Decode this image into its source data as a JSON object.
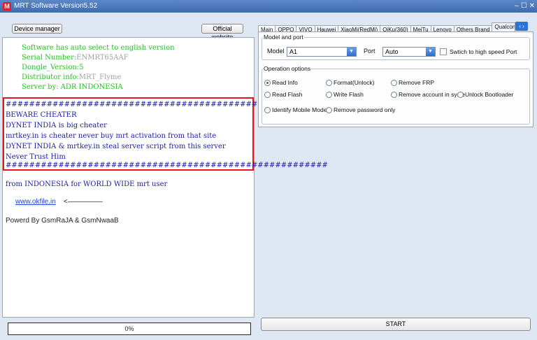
{
  "window": {
    "title": "MRT Software Version5.52",
    "app_icon_glyph": "M",
    "minimize_glyph": "–",
    "close_glyph": "☐ ✕"
  },
  "left": {
    "device_manager_label": "Device manager",
    "official_website_label": "Official website",
    "info_lines": {
      "auto_select": "Software has auto select to english version",
      "serial_label": "Serial Number:",
      "serial_value": "ENMRT65AAF",
      "dongle": "Dongle_Version:5",
      "distributor_label": "Distributor info:",
      "distributor_value": "MRT_Flyme",
      "server": "Server by: ADR INDONESIA"
    },
    "warning": {
      "hash_line_top": "#######################################################",
      "line1": "BEWARE CHEATER",
      "line2": "DYNET INDIA is big cheater",
      "line3": "mrtkey.in is cheater never buy mrt activation from that site",
      "line4": "DYNET INDIA & mrtkey.in steal server script from this server",
      "line5": "Never Trust Him",
      "hash_line_bottom": "#######################################################"
    },
    "from_line": "from INDONESIA for WORLD WIDE mrt user",
    "link_text": "www.okfile.in",
    "link_arrow": "<—————",
    "powered_by": "Powerd By GsmRaJA & GsmNwaaB",
    "progress_text": "0%"
  },
  "right": {
    "tabs": [
      "Main",
      "OPPO",
      "VIVO",
      "Hauwei",
      "XiaoMi(RedMi)",
      "QiKu(360)",
      "MeiTu",
      "Lenovo",
      "Others Brand",
      "Qualcom"
    ],
    "tab_arrows": "‹ ›",
    "model_group_title": "Model and port",
    "model_label": "Model",
    "model_value": "A1",
    "port_label": "Port",
    "port_value": "Auto",
    "high_speed_label": "Swtich to high speed Port",
    "ops_group_title": "Operation options",
    "options": {
      "read_info": "Read Info",
      "format_unlock": "Format(Unlock)",
      "remove_frp": "Remove FRP",
      "read_flash": "Read Flash",
      "write_flash": "Write Flash",
      "remove_account": "Remove account in syste",
      "unlock_bootloader": "Unlock Bootloader",
      "identify_model": "Identify Mobile Model",
      "remove_password": "Remove password only"
    },
    "start_label": "START",
    "combo_arrow_glyph": "▼"
  },
  "colors": {
    "title_bar": "#4a78bf",
    "warning_border": "#e11b1b",
    "info_green": "#22c422",
    "warning_blue": "#1a1aa8"
  }
}
